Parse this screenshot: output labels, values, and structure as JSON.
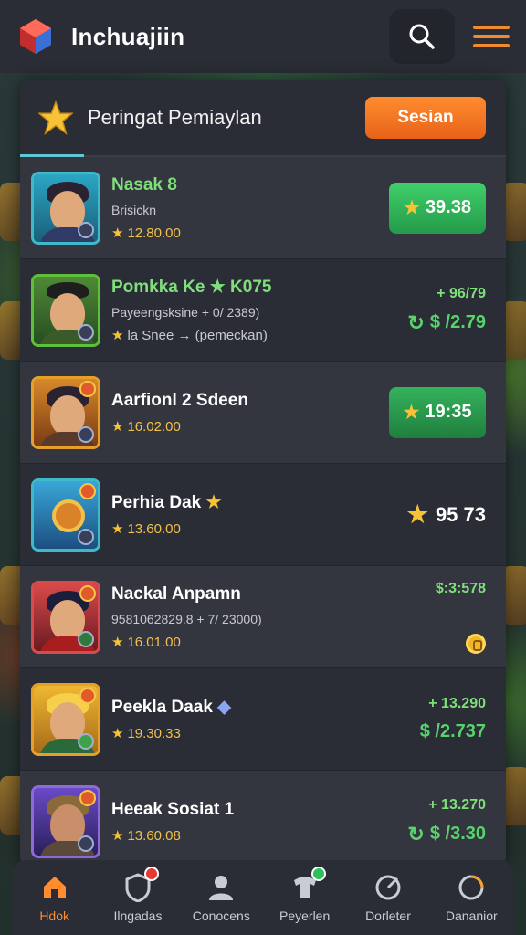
{
  "app": {
    "title": "Inchuajiin"
  },
  "panel": {
    "title": "Peringat Pemiaylan",
    "action_label": "Sesian"
  },
  "players": [
    {
      "name": "Nasak 8",
      "sub": "Brisickn",
      "meta": "12.80.00",
      "right_type": "pill",
      "value": "39.38"
    },
    {
      "name": "Pomkka Ke ★ K075",
      "sub": "Payeengsksine + 0/ 2389)",
      "meta": "la Snee → (pemeckan)",
      "right_type": "delta",
      "delta": "+ 96/79",
      "money": "$ /2.79"
    },
    {
      "name": "Aarfionl 2 Sdeen",
      "sub": "",
      "meta": "16.02.00",
      "right_type": "pill",
      "value": "19:35"
    },
    {
      "name": "Perhia Dak",
      "sub": "",
      "meta": "13.60.00",
      "right_type": "score",
      "value": "95 73"
    },
    {
      "name": "Nackal Anpamn",
      "sub": "9581062829.8 + 7/ 23000)",
      "meta": "16.01.00",
      "right_type": "coin",
      "delta": "$:3:578"
    },
    {
      "name": "Peekla Daak",
      "sub": "",
      "meta": "19.30.33",
      "right_type": "delta",
      "delta": "+ 13.290",
      "money": "$ /2.737"
    },
    {
      "name": "Heeak Sosiat 1",
      "sub": "",
      "meta": "13.60.08",
      "right_type": "delta",
      "delta": "+ 13.270",
      "money": "$ /3.30"
    }
  ],
  "nav": [
    {
      "label": "Hdok",
      "icon": "home-icon",
      "active": true
    },
    {
      "label": "Ilngadas",
      "icon": "shield-icon"
    },
    {
      "label": "Conocens",
      "icon": "user-icon"
    },
    {
      "label": "Peyerlen",
      "icon": "tshirt-icon"
    },
    {
      "label": "Dorleter",
      "icon": "target-icon"
    },
    {
      "label": "Dananior",
      "icon": "loading-icon"
    }
  ],
  "colors": {
    "accent": "#ff8c2e",
    "positive": "#3fcf6a",
    "panel": "#2b2d36"
  }
}
